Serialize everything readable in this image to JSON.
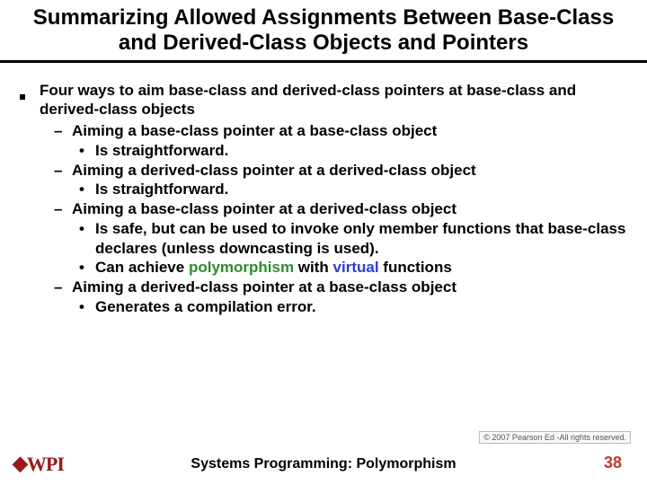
{
  "title": "Summarizing Allowed Assignments Between Base-Class and Derived-Class Objects and Pointers",
  "main_line": "Four ways to aim base-class and derived-class pointers at base-class and derived-class objects",
  "items": [
    {
      "heading": "Aiming a base-class pointer at a base-class object",
      "subs": [
        "Is straightforward."
      ]
    },
    {
      "heading": "Aiming a derived-class pointer at a derived-class object",
      "subs": [
        "Is straightforward."
      ]
    },
    {
      "heading": "Aiming a base-class pointer at a derived-class object",
      "subs": [
        "Is safe, but can be used to invoke only member functions that base-class declares (unless downcasting is used).",
        "Can achieve polymorphism with virtual functions"
      ]
    },
    {
      "heading": "Aiming a derived-class pointer at a base-class object",
      "subs": [
        "Generates a compilation error."
      ]
    }
  ],
  "keywords": {
    "polymorphism": "polymorphism",
    "virtual": "virtual"
  },
  "footer_title": "Systems Programming: Polymorphism",
  "page_number": "38",
  "copyright": "© 2007 Pearson Ed -All rights reserved.",
  "logo_text": "WPI"
}
